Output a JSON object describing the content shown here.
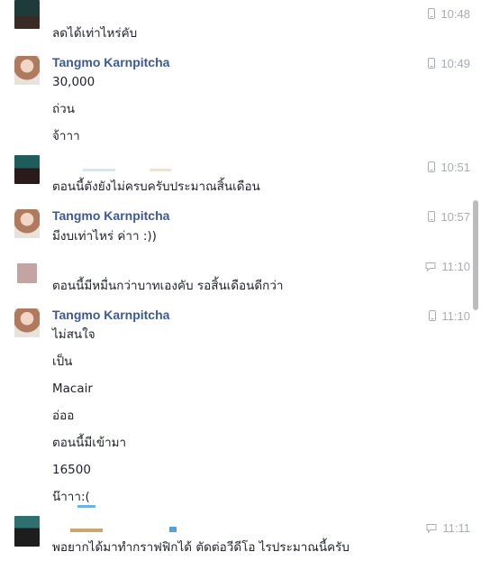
{
  "messages": [
    {
      "sender": "",
      "time": "10:48",
      "lines": [
        "ลดได้เท่าไหร่คับ"
      ],
      "device": "mobile"
    },
    {
      "sender": "Tangmo Karnpitcha",
      "time": "10:49",
      "lines": [
        "30,000",
        "ถ่วน",
        "จ้าาา"
      ],
      "device": "mobile"
    },
    {
      "sender": "",
      "time": "10:51",
      "lines": [
        "ตอนนี้ตังยังไม่ครบครับประมาณสิ้นเดือน"
      ],
      "device": "mobile"
    },
    {
      "sender": "Tangmo Karnpitcha",
      "time": "10:57",
      "lines": [
        "มีงบเท่าไหร่ ค่าา :))"
      ],
      "device": "mobile"
    },
    {
      "sender": "",
      "time": "11:10",
      "lines": [
        "ตอนนี้มีหมื่นกว่าบาทเองคับ รอสิ้นเดือนดีกว่า"
      ],
      "device": "chat"
    },
    {
      "sender": "Tangmo Karnpitcha",
      "time": "11:10",
      "lines": [
        "ไม่สนใจ",
        "เป็น",
        "Macair",
        "อ่ออ",
        "ตอนนี้มีเข้ามา",
        "16500",
        "น๊าาา:("
      ],
      "device": "mobile"
    },
    {
      "sender": "",
      "time": "11:11",
      "lines": [
        "พอยากได้มาทำกราฟฟิกได้ ตัดต่อวีดีโอ ไรประมาณนี้ครับ"
      ],
      "device": "chat"
    }
  ],
  "colors": {
    "name": "#3b5998",
    "text": "#1d2129",
    "time": "#a7acb5"
  },
  "icons": {
    "mobile": "mobile-phone-icon",
    "chat": "chat-bubble-icon"
  }
}
